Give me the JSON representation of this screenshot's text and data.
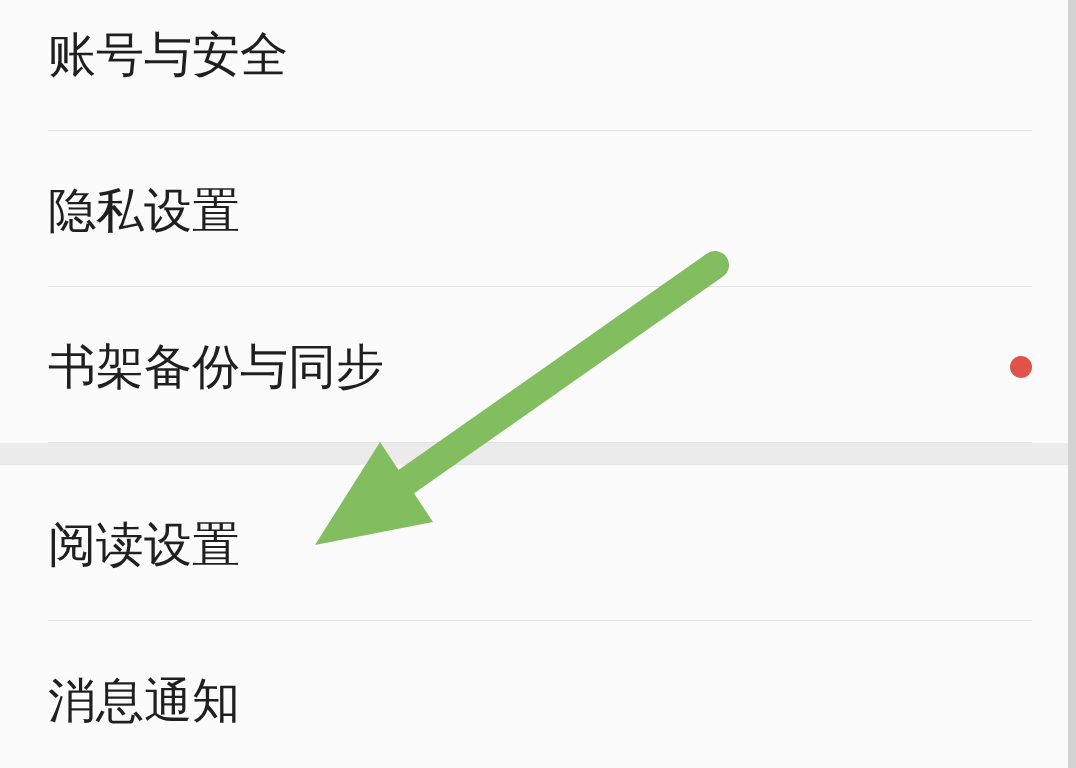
{
  "sections": [
    {
      "items": [
        {
          "label": "账号与安全",
          "dot": false
        },
        {
          "label": "隐私设置",
          "dot": false
        },
        {
          "label": "书架备份与同步",
          "dot": true
        }
      ]
    },
    {
      "items": [
        {
          "label": "阅读设置",
          "dot": false
        },
        {
          "label": "消息通知",
          "dot": false
        }
      ]
    }
  ],
  "annotations": [
    {
      "kind": "arrow"
    }
  ]
}
